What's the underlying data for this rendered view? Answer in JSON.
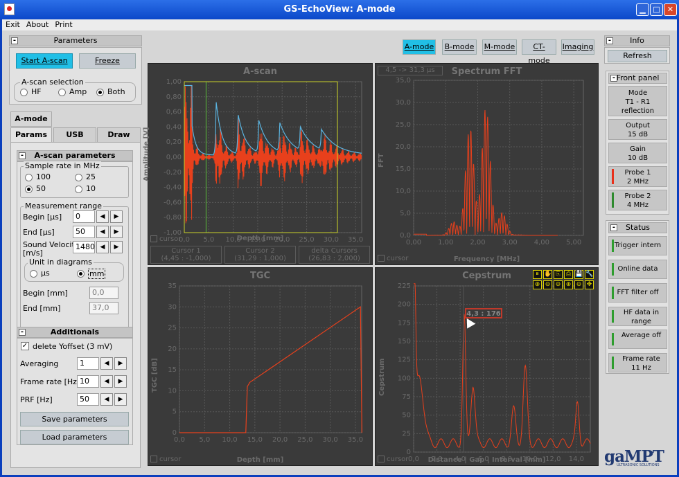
{
  "window": {
    "title": "GS-EchoView: A-mode",
    "min": "▁",
    "max": "□",
    "close": "✕"
  },
  "menu": [
    "Exit",
    "About",
    "Print"
  ],
  "params": {
    "header": "Parameters",
    "start": "Start A-scan",
    "freeze": "Freeze",
    "selection_label": "A-scan selection",
    "opts": [
      "HF",
      "Amp",
      "Both"
    ]
  },
  "tabs": {
    "amode": "A-mode",
    "params": "Params",
    "usb": "USB",
    "draw": "Draw"
  },
  "ascan_params": {
    "header": "A-scan parameters",
    "sample_label": "Sample rate  in MHz",
    "rates": [
      "100",
      "25",
      "50",
      "10"
    ],
    "meas_label": "Measurement range",
    "begin_us": "Begin [µs]",
    "begin_us_val": "0",
    "end_us": "End [µs]",
    "end_us_val": "50",
    "sv_label1": "Sound Velocity",
    "sv_label2": "[m/s]",
    "sv_val": "1480",
    "unit_label": "Unit in diagrams",
    "unit_us": "µs",
    "unit_mm": "mm",
    "begin_mm": "Begin [mm]",
    "begin_mm_val": "0,0",
    "end_mm": "End [mm]",
    "end_mm_val": "37,0"
  },
  "additionals": {
    "header": "Additionals",
    "delete": "delete Yoffset (3 mV)",
    "averaging": "Averaging",
    "avg_val": "1",
    "frame": "Frame rate [Hz]",
    "frame_val": "10",
    "prf": "PRF [Hz]",
    "prf_val": "50",
    "save": "Save parameters",
    "load": "Load parameters"
  },
  "modes": [
    "A-mode",
    "B-mode",
    "M-mode",
    "CT-mode",
    "Imaging"
  ],
  "plots": {
    "ascan": {
      "title": "A-scan",
      "ylabel": "Amplitude [V]",
      "xlabel": "Depth [mm]",
      "yticks": [
        "1,00",
        "0,80",
        "0,60",
        "0,40",
        "0,20",
        "0,00",
        "-0,20",
        "-0,40",
        "-0,60",
        "-0,80",
        "-1,00"
      ],
      "xticks": [
        "0,0",
        "5,0",
        "10,0",
        "15,0",
        "20,0",
        "25,0",
        "30,0",
        "35,0"
      ],
      "cursor": "cursor",
      "c1": "Cursor 1",
      "c1v": "(4,45 : -1,000)",
      "c2": "Cursor 2",
      "c2v": "(31,29 : 1,000)",
      "dc": "delta Cursors",
      "dcv": "(26,83 : 2,000)"
    },
    "fft": {
      "title": "Spectrum FFT",
      "ylabel": "FFT",
      "xlabel": "Frequency [MHz]",
      "range": "4,5 -> 31,3 µs",
      "yticks": [
        "35,0",
        "30,0",
        "25,0",
        "20,0",
        "15,0",
        "10,0",
        "5,0",
        "0,0"
      ],
      "xticks": [
        "0,00",
        "1,00",
        "2,00",
        "3,00",
        "4,00",
        "5,00"
      ],
      "cursor": "cursor"
    },
    "tgc": {
      "title": "TGC",
      "ylabel": "TGC [dB]",
      "xlabel": "Depth [mm]",
      "yticks": [
        "35",
        "30",
        "25",
        "20",
        "15",
        "10",
        "5",
        "0"
      ],
      "xticks": [
        "0,0",
        "5,0",
        "10,0",
        "15,0",
        "20,0",
        "25,0",
        "30,0",
        "35,0"
      ],
      "cursor": "cursor"
    },
    "cep": {
      "title": "Cepstrum",
      "ylabel": "Cepstrum",
      "xlabel": "Distance | Gap | Interval [mm]",
      "readout": "4,3 : 176",
      "yticks": [
        "225",
        "200",
        "175",
        "150",
        "125",
        "100",
        "75",
        "50",
        "25",
        "0"
      ],
      "xticks": [
        "0,0",
        "2,0",
        "4,0",
        "6,0",
        "8,0",
        "10,0",
        "12,0",
        "14,0"
      ],
      "cursor": "cursor",
      "tools": [
        "⏸",
        "✋",
        "⎘",
        "⎙",
        "💾",
        "🔧",
        "⊕",
        "⊖",
        "⊖",
        "⊕",
        "⊖",
        "✥"
      ]
    }
  },
  "info": {
    "header": "Info",
    "refresh": "Refresh",
    "front": "Front panel",
    "mode": "Mode\nT1 - R1\nreflection",
    "output": "Output\n15 dB",
    "gain": "Gain\n10 dB",
    "probe1": "Probe 1\n2 MHz",
    "probe2": "Probe 2\n4 MHz",
    "probe1_color": "#e8301a",
    "probe2_color": "#2e8a2e"
  },
  "status": {
    "header": "Status",
    "items": [
      "Trigger intern",
      "Online data",
      "FFT filter off",
      "HF data in range",
      "Average off",
      "Frame rate 11 Hz"
    ]
  },
  "logo": {
    "name": "gaMPT",
    "sub": "ULTRASONIC SOLUTIONS"
  },
  "colors": {
    "accent": "#21bfe6",
    "signal": "#e8401c",
    "envelope": "#5ab4e0",
    "cursor": "#c8d02a"
  }
}
